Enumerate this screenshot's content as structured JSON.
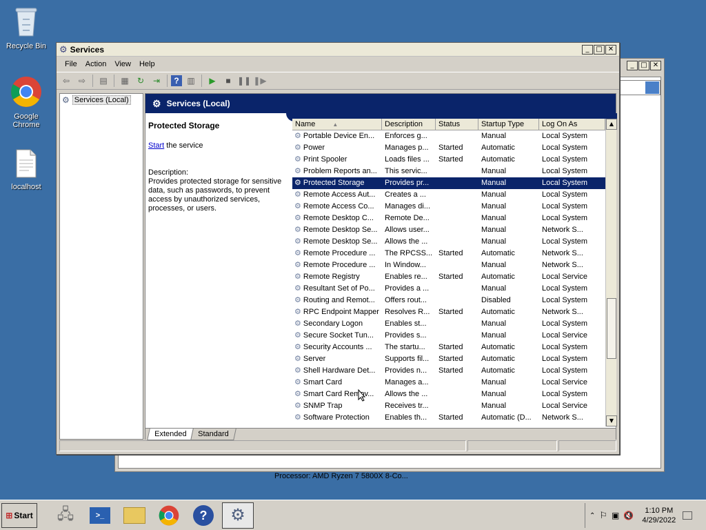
{
  "desktop": {
    "icons": [
      {
        "label": "Recycle Bin"
      },
      {
        "label": "Google Chrome"
      },
      {
        "label": "localhost"
      }
    ]
  },
  "background_window": {
    "processor_text": "Processor: AMD Ryzen 7 5800X 8-Co..."
  },
  "window": {
    "title": "Services",
    "menu": [
      "File",
      "Action",
      "View",
      "Help"
    ],
    "tree_item": "Services (Local)",
    "panel_header": "Services (Local)",
    "details": {
      "service_name": "Protected Storage",
      "start_link": "Start",
      "start_suffix": " the service",
      "description_label": "Description:",
      "description_text": "Provides protected storage for sensitive data, such as passwords, to prevent access by unauthorized services, processes, or users."
    },
    "columns": [
      "Name",
      "Description",
      "Status",
      "Startup Type",
      "Log On As"
    ],
    "rows": [
      {
        "name": "Portable Device En...",
        "desc": "Enforces g...",
        "status": "",
        "startup": "Manual",
        "logon": "Local System"
      },
      {
        "name": "Power",
        "desc": "Manages p...",
        "status": "Started",
        "startup": "Automatic",
        "logon": "Local System"
      },
      {
        "name": "Print Spooler",
        "desc": "Loads files ...",
        "status": "Started",
        "startup": "Automatic",
        "logon": "Local System"
      },
      {
        "name": "Problem Reports an...",
        "desc": "This servic...",
        "status": "",
        "startup": "Manual",
        "logon": "Local System"
      },
      {
        "name": "Protected Storage",
        "desc": "Provides pr...",
        "status": "",
        "startup": "Manual",
        "logon": "Local System",
        "selected": true
      },
      {
        "name": "Remote Access Aut...",
        "desc": "Creates a ...",
        "status": "",
        "startup": "Manual",
        "logon": "Local System"
      },
      {
        "name": "Remote Access Co...",
        "desc": "Manages di...",
        "status": "",
        "startup": "Manual",
        "logon": "Local System"
      },
      {
        "name": "Remote Desktop C...",
        "desc": "Remote De...",
        "status": "",
        "startup": "Manual",
        "logon": "Local System"
      },
      {
        "name": "Remote Desktop Se...",
        "desc": "Allows user...",
        "status": "",
        "startup": "Manual",
        "logon": "Network S..."
      },
      {
        "name": "Remote Desktop Se...",
        "desc": "Allows the ...",
        "status": "",
        "startup": "Manual",
        "logon": "Local System"
      },
      {
        "name": "Remote Procedure ...",
        "desc": "The RPCSS...",
        "status": "Started",
        "startup": "Automatic",
        "logon": "Network S..."
      },
      {
        "name": "Remote Procedure ...",
        "desc": "In Window...",
        "status": "",
        "startup": "Manual",
        "logon": "Network S..."
      },
      {
        "name": "Remote Registry",
        "desc": "Enables re...",
        "status": "Started",
        "startup": "Automatic",
        "logon": "Local Service"
      },
      {
        "name": "Resultant Set of Po...",
        "desc": "Provides a ...",
        "status": "",
        "startup": "Manual",
        "logon": "Local System"
      },
      {
        "name": "Routing and Remot...",
        "desc": "Offers rout...",
        "status": "",
        "startup": "Disabled",
        "logon": "Local System"
      },
      {
        "name": "RPC Endpoint Mapper",
        "desc": "Resolves R...",
        "status": "Started",
        "startup": "Automatic",
        "logon": "Network S..."
      },
      {
        "name": "Secondary Logon",
        "desc": "Enables st...",
        "status": "",
        "startup": "Manual",
        "logon": "Local System"
      },
      {
        "name": "Secure Socket Tun...",
        "desc": "Provides s...",
        "status": "",
        "startup": "Manual",
        "logon": "Local Service"
      },
      {
        "name": "Security Accounts ...",
        "desc": "The startu...",
        "status": "Started",
        "startup": "Automatic",
        "logon": "Local System"
      },
      {
        "name": "Server",
        "desc": "Supports fil...",
        "status": "Started",
        "startup": "Automatic",
        "logon": "Local System"
      },
      {
        "name": "Shell Hardware Det...",
        "desc": "Provides n...",
        "status": "Started",
        "startup": "Automatic",
        "logon": "Local System"
      },
      {
        "name": "Smart Card",
        "desc": "Manages a...",
        "status": "",
        "startup": "Manual",
        "logon": "Local Service"
      },
      {
        "name": "Smart Card Remov...",
        "desc": "Allows the ...",
        "status": "",
        "startup": "Manual",
        "logon": "Local System"
      },
      {
        "name": "SNMP Trap",
        "desc": "Receives tr...",
        "status": "",
        "startup": "Manual",
        "logon": "Local Service"
      },
      {
        "name": "Software Protection",
        "desc": "Enables th...",
        "status": "Started",
        "startup": "Automatic (D...",
        "logon": "Network S..."
      }
    ],
    "tabs": [
      "Extended",
      "Standard"
    ],
    "active_tab": "Extended"
  },
  "taskbar": {
    "start_label": "Start",
    "clock_time": "1:10 PM",
    "clock_date": "4/29/2022"
  },
  "colors": {
    "desktop": "#3a6ea5",
    "selection": "#0a246a",
    "header": "#0a246a"
  }
}
